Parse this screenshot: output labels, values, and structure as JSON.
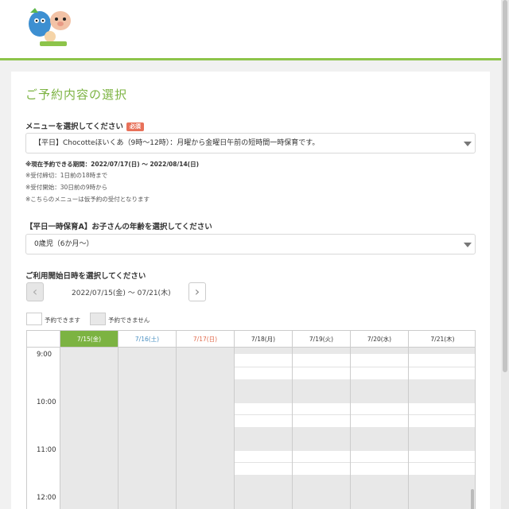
{
  "page": {
    "title": "ご予約内容の選択"
  },
  "menu": {
    "label": "メニューを選択してください",
    "required_badge": "必須",
    "selected": "【平日】Chocotteほいくあ（9時〜12時）：月曜から金曜日午前の短時間一時保育です。",
    "notes": [
      "※現在予約できる期間：2022/07/17(日) 〜 2022/08/14(日)",
      "※受付締切：1日前の18時まで",
      "※受付開始：30日前の9時から",
      "※こちらのメニューは仮予約の受付となります"
    ]
  },
  "age": {
    "label": "【平日一時保育A】お子さんの年齢を選択してください",
    "selected": "0歳児（6か月〜）"
  },
  "date": {
    "label": "ご利用開始日時を選択してください",
    "prev_icon": "‹",
    "next_icon": "›",
    "range": "2022/07/15(金) 〜 07/21(木)"
  },
  "legend": {
    "available": "予約できます",
    "unavailable": "予約できません"
  },
  "calendar": {
    "days": [
      {
        "label": "7/15(金)",
        "state": "active",
        "closed": true
      },
      {
        "label": "7/16(土)",
        "state": "sat",
        "closed": true
      },
      {
        "label": "7/17(日)",
        "state": "sun",
        "closed": true
      },
      {
        "label": "7/18(月)",
        "state": "normal",
        "closed": false
      },
      {
        "label": "7/19(火)",
        "state": "normal",
        "closed": false
      },
      {
        "label": "7/20(水)",
        "state": "normal",
        "closed": false
      },
      {
        "label": "7/21(木)",
        "state": "normal",
        "closed": false
      }
    ],
    "times": [
      "9:00",
      "10:00",
      "11:00",
      "12:00"
    ]
  },
  "colors": {
    "accent": "#7cb342",
    "saturday": "#4a90c2",
    "sunday": "#e06a4c",
    "required": "#e8715a",
    "unavailable": "#e8e8e8"
  },
  "icons": {
    "logo": "mascot-logo",
    "dropdown": "triangle-down-icon"
  }
}
